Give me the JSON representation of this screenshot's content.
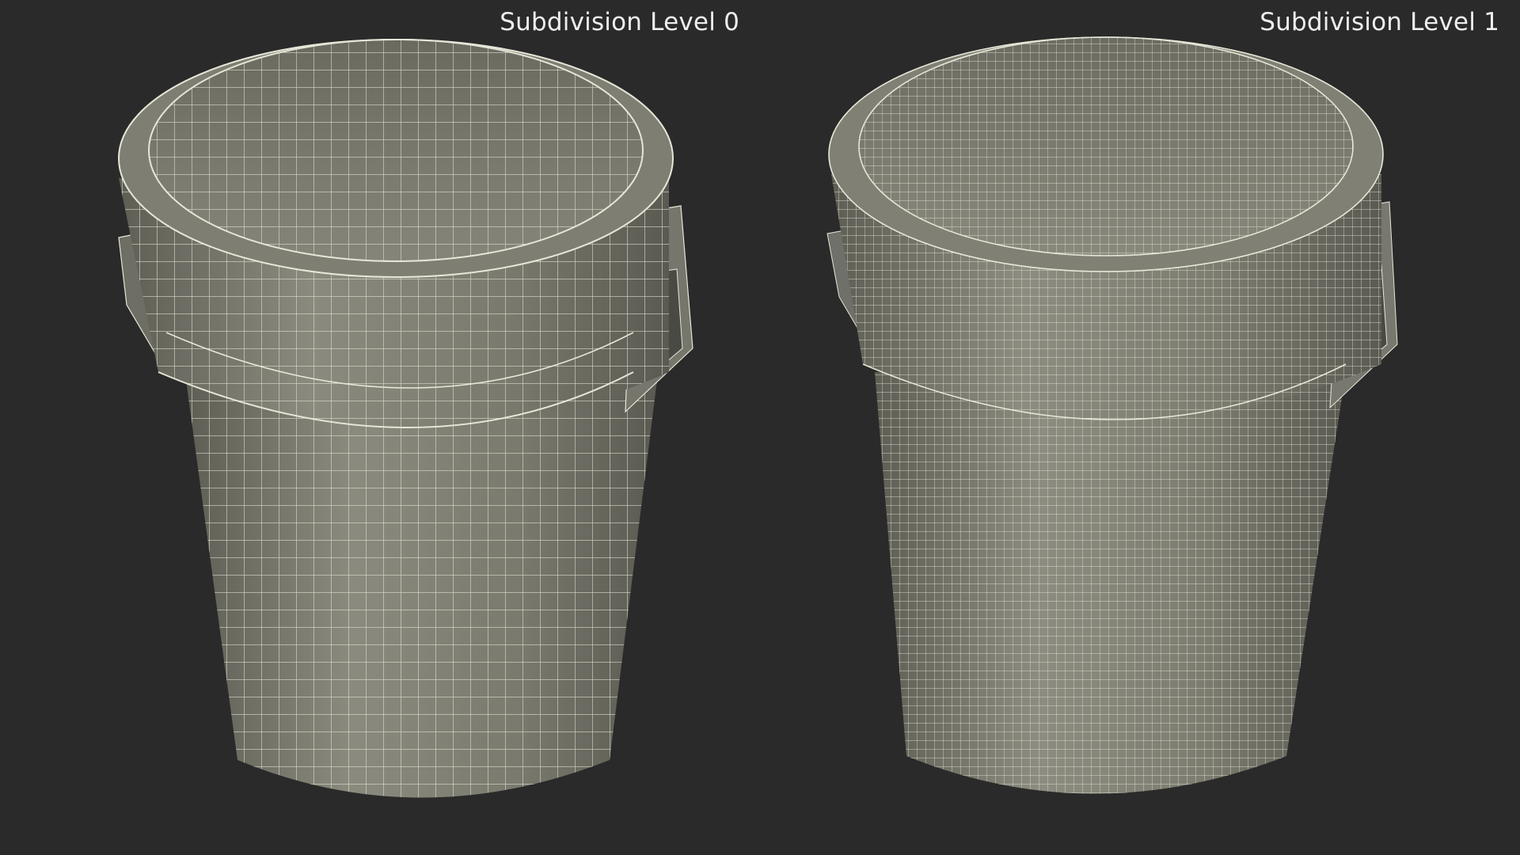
{
  "viewport": {
    "background": "#2a2a2a"
  },
  "panels": [
    {
      "label": "Subdivision Level 0",
      "mesh_density": "coarse",
      "model": "wireframe-trash-can-icon"
    },
    {
      "label": "Subdivision Level 1",
      "mesh_density": "fine",
      "model": "wireframe-trash-can-icon"
    }
  ],
  "colors": {
    "surface": "#7a7a6e",
    "surface_light": "#8c8c80",
    "surface_dark": "#5e5e55",
    "wire": "#e6e6d8"
  }
}
